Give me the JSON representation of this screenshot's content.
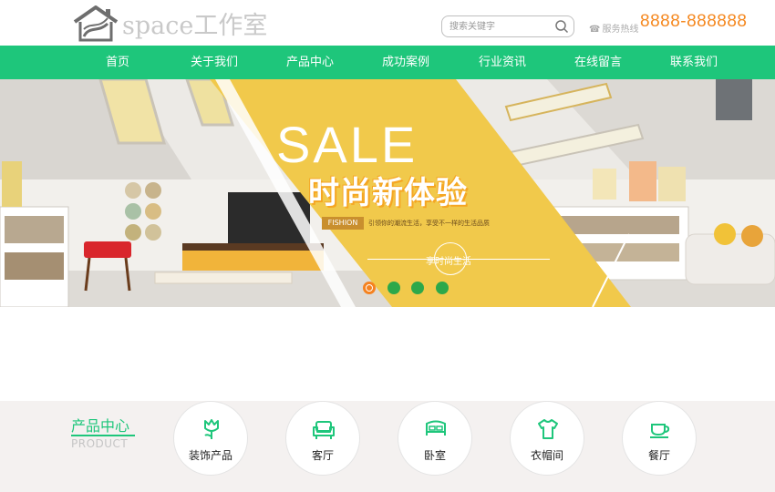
{
  "header": {
    "logo_text": "space工作室",
    "search_placeholder": "搜索关键字",
    "hotline_label": "服务热线",
    "phone": "8888-888888"
  },
  "nav": {
    "items": [
      {
        "label": "首页"
      },
      {
        "label": "关于我们"
      },
      {
        "label": "产品中心"
      },
      {
        "label": "成功案例"
      },
      {
        "label": "行业资讯"
      },
      {
        "label": "在线留言"
      },
      {
        "label": "联系我们"
      }
    ]
  },
  "banner": {
    "headline": "SALE",
    "slogan": "时尚新体验",
    "tag": "FISHION",
    "tagline": "引领你的潮流生活，享受不一样的生活品质",
    "circle_text": "享时尚生活",
    "slides": 4,
    "active_slide": 1
  },
  "products": {
    "title": "产品中心",
    "subtitle": "PRODUCT",
    "categories": [
      {
        "label": "装饰产品",
        "icon": "tulip-icon"
      },
      {
        "label": "客厅",
        "icon": "sofa-icon"
      },
      {
        "label": "卧室",
        "icon": "bed-icon"
      },
      {
        "label": "衣帽间",
        "icon": "shirt-icon"
      },
      {
        "label": "餐厅",
        "icon": "cup-icon"
      }
    ]
  },
  "colors": {
    "brand_green": "#1ec67b",
    "phone_orange": "#f5881f",
    "banner_yellow": "#f1c94b"
  }
}
